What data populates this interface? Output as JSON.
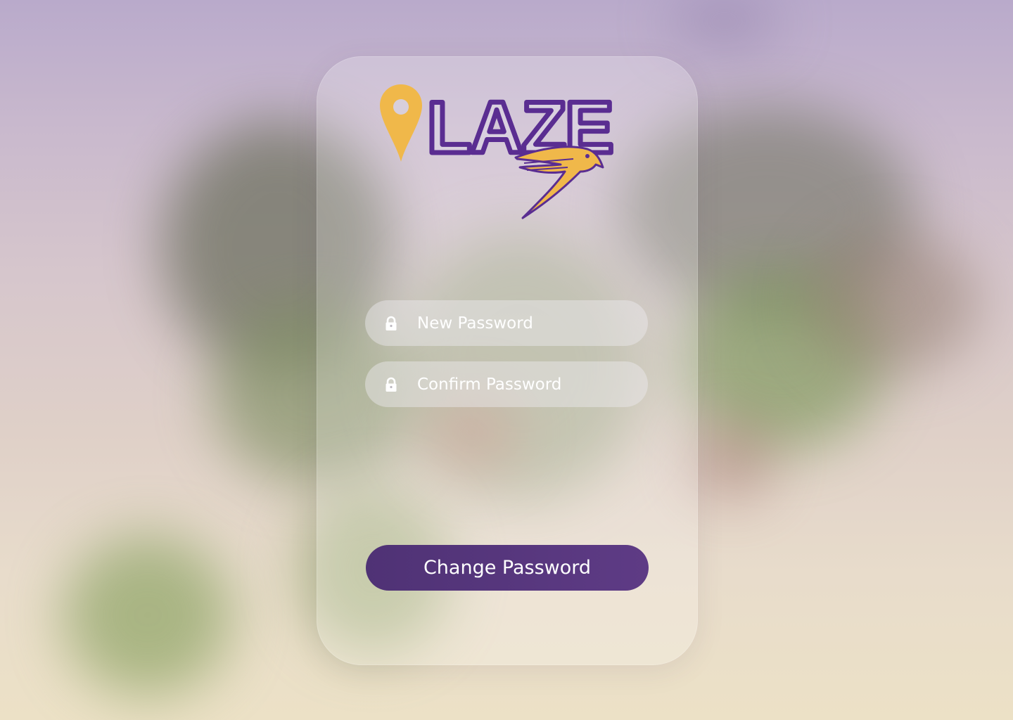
{
  "brand": {
    "logo_text": "LAZE",
    "purple": "#5a2d91",
    "gold": "#f0b84a"
  },
  "form": {
    "new_password": {
      "placeholder": "New Password",
      "icon": "lock-icon"
    },
    "confirm_password": {
      "placeholder": "Confirm Password",
      "icon": "lock-icon"
    },
    "submit_label": "Change Password"
  },
  "colors": {
    "button_bg": "#553580",
    "button_text": "#ffffff",
    "field_bg": "#e9e6ee"
  }
}
